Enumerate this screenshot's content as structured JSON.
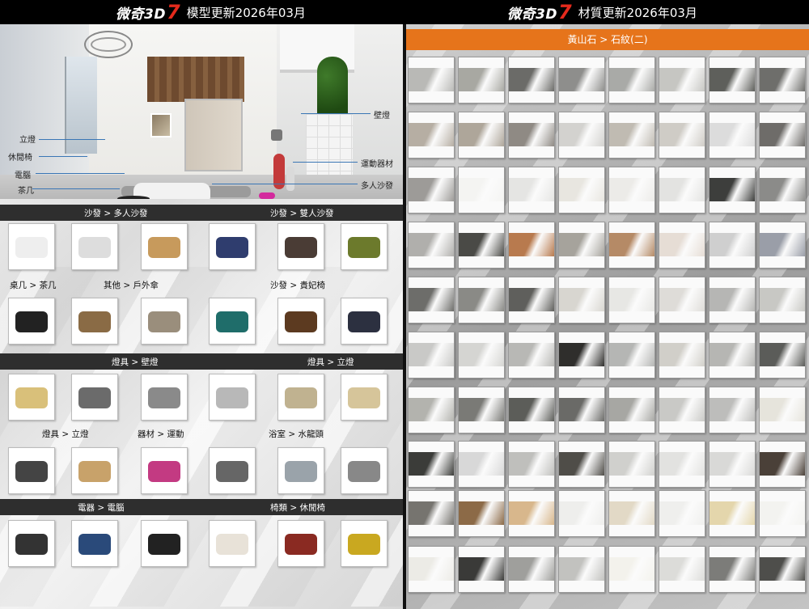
{
  "header": {
    "left": {
      "logo_text": "微奇3D",
      "logo_num": "7",
      "title": "模型更新2026年03月"
    },
    "right": {
      "logo_text": "微奇3D",
      "logo_num": "7",
      "title": "材質更新2026年03月"
    }
  },
  "scene_callouts": [
    "立燈",
    "休閒椅",
    "電腦",
    "茶几",
    "壁燈",
    "運動器材",
    "多人沙發"
  ],
  "model_sections": [
    {
      "labels": [
        "沙發 > 多人沙發",
        "沙發 > 雙人沙發"
      ],
      "style": "dark"
    },
    {
      "labels": [
        "桌几 > 茶几",
        "其他 > 戶外傘",
        "沙發 > 貴妃椅"
      ],
      "style": "light"
    },
    {
      "labels": [
        "燈具 > 壁燈",
        "燈具 > 立燈"
      ],
      "style": "dark"
    },
    {
      "labels": [
        "燈具 > 立燈",
        "器材 > 運動",
        "浴室 > 水龍頭"
      ],
      "style": "light"
    },
    {
      "labels": [
        "電器 > 電腦",
        "椅類 > 休閒椅"
      ],
      "style": "dark"
    }
  ],
  "material_header": "黃山石 > 石紋(二)",
  "colors": {
    "accent_orange": "#e6741b",
    "logo_red": "#e52a1c",
    "section_dark": "#2e2e2e"
  },
  "swatch_rows": [
    [
      "#b9b9b6",
      "#a8a8a2",
      "#6b6b68",
      "#8e8e8c",
      "#a9aaa7",
      "#c6c6c2",
      "#5e5f5b",
      "#6e6e6b"
    ],
    [
      "#b6aea3",
      "#aea69a",
      "#8f8a84",
      "#d3d2cf",
      "#c0bbb2",
      "#cfccc6",
      "#dcdcdc",
      "#6e6c69"
    ],
    [
      "#9d9b98",
      "#f4f4f2",
      "#e5e5e3",
      "#e8e6e0",
      "#ecebe8",
      "#e3e3e1",
      "#3d3e3c",
      "#8b8b89"
    ],
    [
      "#b0afac",
      "#4a4a46",
      "#b87a4e",
      "#a6a39c",
      "#b58a66",
      "#e6ddd5",
      "#cfcfcf",
      "#9a9ea8"
    ],
    [
      "#6d6d6a",
      "#8a8a86",
      "#5f5f5c",
      "#d8d6d0",
      "#e7e7e4",
      "#dedcd8",
      "#b6b6b4",
      "#c8c8c4"
    ],
    [
      "#c9c9c7",
      "#d5d5d2",
      "#b8b8b5",
      "#2f2e2c",
      "#b5b6b4",
      "#d1cfc9",
      "#b6b6b3",
      "#5b5c59"
    ],
    [
      "#b3b3ae",
      "#7a7a76",
      "#5c5d59",
      "#6a6a67",
      "#a7a7a3",
      "#c9c9c6",
      "#bdbdbb",
      "#e6e4dc"
    ],
    [
      "#3b3c39",
      "#d8d8d8",
      "#bfbfbc",
      "#4f4d48",
      "#d0d0cd",
      "#e2e2e0",
      "#d9d9d7",
      "#4a4038"
    ],
    [
      "#76746f",
      "#8c6a47",
      "#d8b78c",
      "#eeeeec",
      "#e2d9c6",
      "#efefed",
      "#e4d6ac",
      "#f3f3f0"
    ],
    [
      "#ecebe6",
      "#3a3a38",
      "#9f9f9c",
      "#c2c2bf",
      "#f3f2ec",
      "#dcdcd9",
      "#7c7c79",
      "#4e4e4b"
    ]
  ],
  "icons": [
    "scene-illustration",
    "product-thumbnail",
    "stone-texture-swatch"
  ]
}
